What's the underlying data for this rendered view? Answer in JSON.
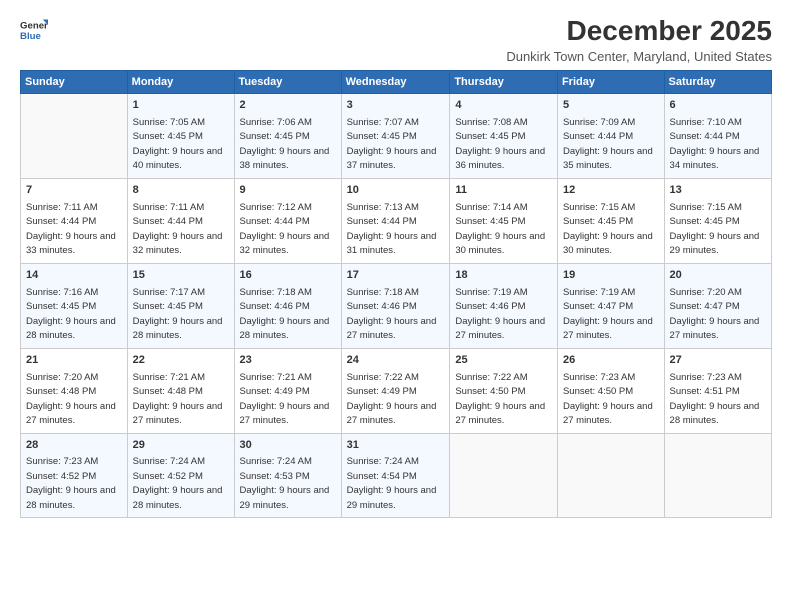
{
  "logo": {
    "general": "General",
    "blue": "Blue"
  },
  "title": "December 2025",
  "subtitle": "Dunkirk Town Center, Maryland, United States",
  "days_header": [
    "Sunday",
    "Monday",
    "Tuesday",
    "Wednesday",
    "Thursday",
    "Friday",
    "Saturday"
  ],
  "weeks": [
    [
      {
        "day": "",
        "sunrise": "",
        "sunset": "",
        "daylight": ""
      },
      {
        "day": "1",
        "sunrise": "Sunrise: 7:05 AM",
        "sunset": "Sunset: 4:45 PM",
        "daylight": "Daylight: 9 hours and 40 minutes."
      },
      {
        "day": "2",
        "sunrise": "Sunrise: 7:06 AM",
        "sunset": "Sunset: 4:45 PM",
        "daylight": "Daylight: 9 hours and 38 minutes."
      },
      {
        "day": "3",
        "sunrise": "Sunrise: 7:07 AM",
        "sunset": "Sunset: 4:45 PM",
        "daylight": "Daylight: 9 hours and 37 minutes."
      },
      {
        "day": "4",
        "sunrise": "Sunrise: 7:08 AM",
        "sunset": "Sunset: 4:45 PM",
        "daylight": "Daylight: 9 hours and 36 minutes."
      },
      {
        "day": "5",
        "sunrise": "Sunrise: 7:09 AM",
        "sunset": "Sunset: 4:44 PM",
        "daylight": "Daylight: 9 hours and 35 minutes."
      },
      {
        "day": "6",
        "sunrise": "Sunrise: 7:10 AM",
        "sunset": "Sunset: 4:44 PM",
        "daylight": "Daylight: 9 hours and 34 minutes."
      }
    ],
    [
      {
        "day": "7",
        "sunrise": "Sunrise: 7:11 AM",
        "sunset": "Sunset: 4:44 PM",
        "daylight": "Daylight: 9 hours and 33 minutes."
      },
      {
        "day": "8",
        "sunrise": "Sunrise: 7:11 AM",
        "sunset": "Sunset: 4:44 PM",
        "daylight": "Daylight: 9 hours and 32 minutes."
      },
      {
        "day": "9",
        "sunrise": "Sunrise: 7:12 AM",
        "sunset": "Sunset: 4:44 PM",
        "daylight": "Daylight: 9 hours and 32 minutes."
      },
      {
        "day": "10",
        "sunrise": "Sunrise: 7:13 AM",
        "sunset": "Sunset: 4:44 PM",
        "daylight": "Daylight: 9 hours and 31 minutes."
      },
      {
        "day": "11",
        "sunrise": "Sunrise: 7:14 AM",
        "sunset": "Sunset: 4:45 PM",
        "daylight": "Daylight: 9 hours and 30 minutes."
      },
      {
        "day": "12",
        "sunrise": "Sunrise: 7:15 AM",
        "sunset": "Sunset: 4:45 PM",
        "daylight": "Daylight: 9 hours and 30 minutes."
      },
      {
        "day": "13",
        "sunrise": "Sunrise: 7:15 AM",
        "sunset": "Sunset: 4:45 PM",
        "daylight": "Daylight: 9 hours and 29 minutes."
      }
    ],
    [
      {
        "day": "14",
        "sunrise": "Sunrise: 7:16 AM",
        "sunset": "Sunset: 4:45 PM",
        "daylight": "Daylight: 9 hours and 28 minutes."
      },
      {
        "day": "15",
        "sunrise": "Sunrise: 7:17 AM",
        "sunset": "Sunset: 4:45 PM",
        "daylight": "Daylight: 9 hours and 28 minutes."
      },
      {
        "day": "16",
        "sunrise": "Sunrise: 7:18 AM",
        "sunset": "Sunset: 4:46 PM",
        "daylight": "Daylight: 9 hours and 28 minutes."
      },
      {
        "day": "17",
        "sunrise": "Sunrise: 7:18 AM",
        "sunset": "Sunset: 4:46 PM",
        "daylight": "Daylight: 9 hours and 27 minutes."
      },
      {
        "day": "18",
        "sunrise": "Sunrise: 7:19 AM",
        "sunset": "Sunset: 4:46 PM",
        "daylight": "Daylight: 9 hours and 27 minutes."
      },
      {
        "day": "19",
        "sunrise": "Sunrise: 7:19 AM",
        "sunset": "Sunset: 4:47 PM",
        "daylight": "Daylight: 9 hours and 27 minutes."
      },
      {
        "day": "20",
        "sunrise": "Sunrise: 7:20 AM",
        "sunset": "Sunset: 4:47 PM",
        "daylight": "Daylight: 9 hours and 27 minutes."
      }
    ],
    [
      {
        "day": "21",
        "sunrise": "Sunrise: 7:20 AM",
        "sunset": "Sunset: 4:48 PM",
        "daylight": "Daylight: 9 hours and 27 minutes."
      },
      {
        "day": "22",
        "sunrise": "Sunrise: 7:21 AM",
        "sunset": "Sunset: 4:48 PM",
        "daylight": "Daylight: 9 hours and 27 minutes."
      },
      {
        "day": "23",
        "sunrise": "Sunrise: 7:21 AM",
        "sunset": "Sunset: 4:49 PM",
        "daylight": "Daylight: 9 hours and 27 minutes."
      },
      {
        "day": "24",
        "sunrise": "Sunrise: 7:22 AM",
        "sunset": "Sunset: 4:49 PM",
        "daylight": "Daylight: 9 hours and 27 minutes."
      },
      {
        "day": "25",
        "sunrise": "Sunrise: 7:22 AM",
        "sunset": "Sunset: 4:50 PM",
        "daylight": "Daylight: 9 hours and 27 minutes."
      },
      {
        "day": "26",
        "sunrise": "Sunrise: 7:23 AM",
        "sunset": "Sunset: 4:50 PM",
        "daylight": "Daylight: 9 hours and 27 minutes."
      },
      {
        "day": "27",
        "sunrise": "Sunrise: 7:23 AM",
        "sunset": "Sunset: 4:51 PM",
        "daylight": "Daylight: 9 hours and 28 minutes."
      }
    ],
    [
      {
        "day": "28",
        "sunrise": "Sunrise: 7:23 AM",
        "sunset": "Sunset: 4:52 PM",
        "daylight": "Daylight: 9 hours and 28 minutes."
      },
      {
        "day": "29",
        "sunrise": "Sunrise: 7:24 AM",
        "sunset": "Sunset: 4:52 PM",
        "daylight": "Daylight: 9 hours and 28 minutes."
      },
      {
        "day": "30",
        "sunrise": "Sunrise: 7:24 AM",
        "sunset": "Sunset: 4:53 PM",
        "daylight": "Daylight: 9 hours and 29 minutes."
      },
      {
        "day": "31",
        "sunrise": "Sunrise: 7:24 AM",
        "sunset": "Sunset: 4:54 PM",
        "daylight": "Daylight: 9 hours and 29 minutes."
      },
      {
        "day": "",
        "sunrise": "",
        "sunset": "",
        "daylight": ""
      },
      {
        "day": "",
        "sunrise": "",
        "sunset": "",
        "daylight": ""
      },
      {
        "day": "",
        "sunrise": "",
        "sunset": "",
        "daylight": ""
      }
    ]
  ]
}
